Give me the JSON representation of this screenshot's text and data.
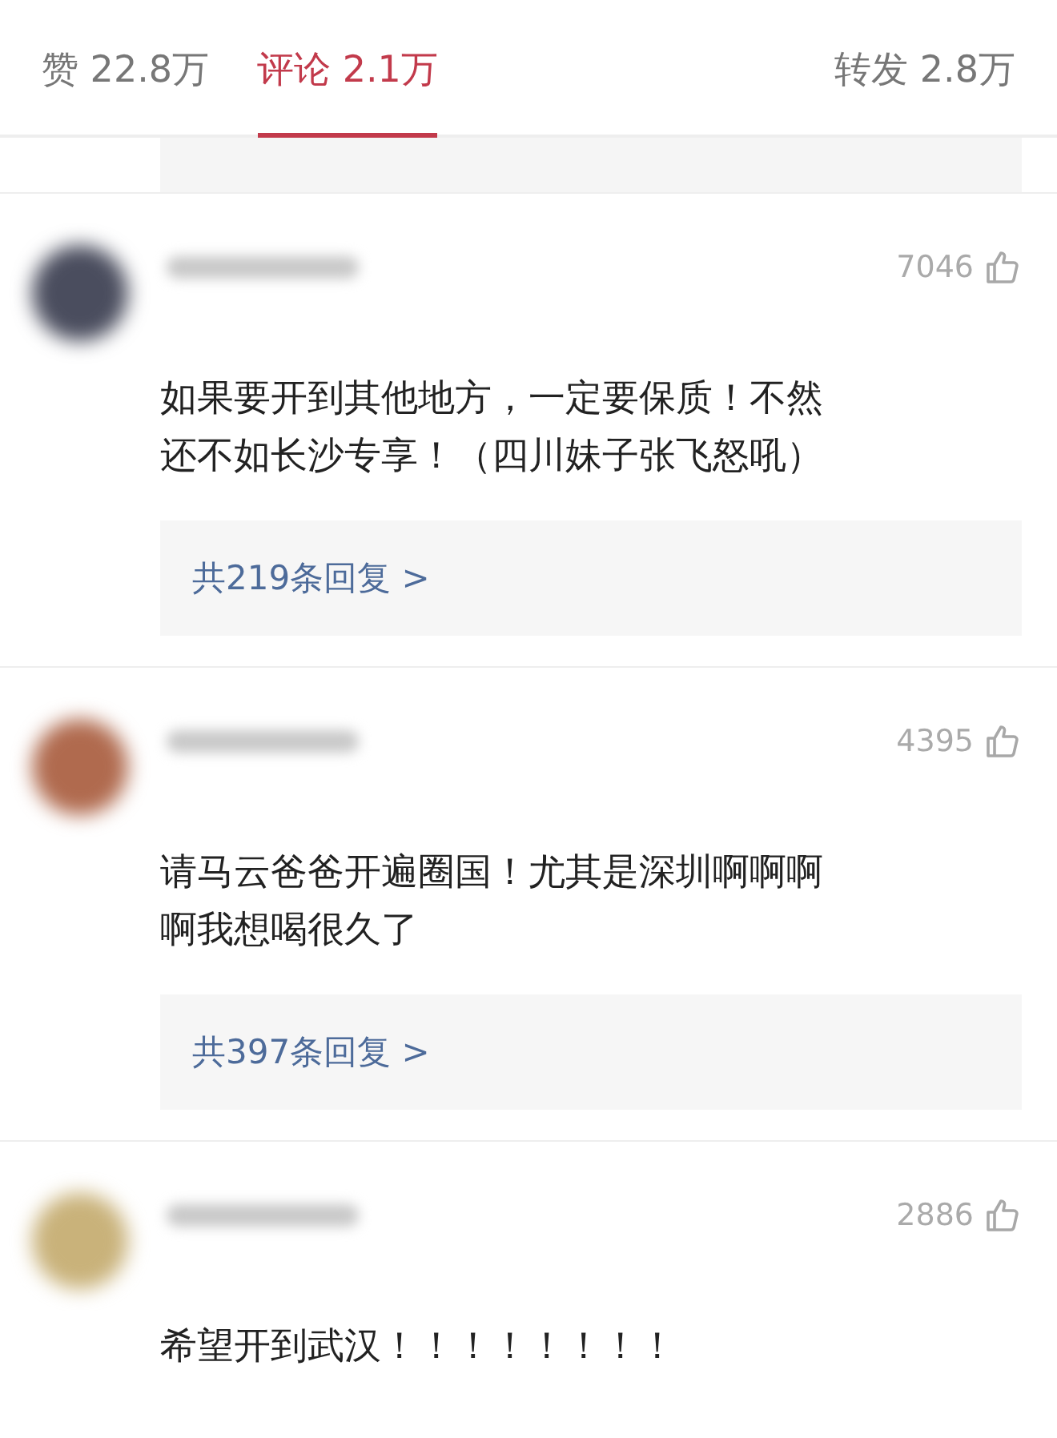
{
  "tabs": [
    {
      "label": "赞 22.8万",
      "selected": false
    },
    {
      "label": "评论 2.1万",
      "selected": true
    },
    {
      "label": "转发 2.8万",
      "selected": false
    }
  ],
  "previous_reply_box": {
    "shown": true
  },
  "comments": [
    {
      "avatar": {
        "color": "#4a4d5e"
      },
      "likes": "7046",
      "lines": [
        "如果要开到其他地方，一定要保质！不然",
        "还不如长沙专享！（四川妹子张飞怒吼）"
      ],
      "replies": "共219条回复 >"
    },
    {
      "avatar": {
        "color": "#b06a4e"
      },
      "likes": "4395",
      "lines": [
        "请马云爸爸开遍圈国！尤其是深圳啊啊啊",
        "啊我想喝很久了"
      ],
      "replies": "共397条回复 >"
    },
    {
      "avatar": {
        "color": "#c9b27a"
      },
      "likes": "2886",
      "lines": [
        "希望开到武汉！！！！！！！！"
      ]
    }
  ]
}
